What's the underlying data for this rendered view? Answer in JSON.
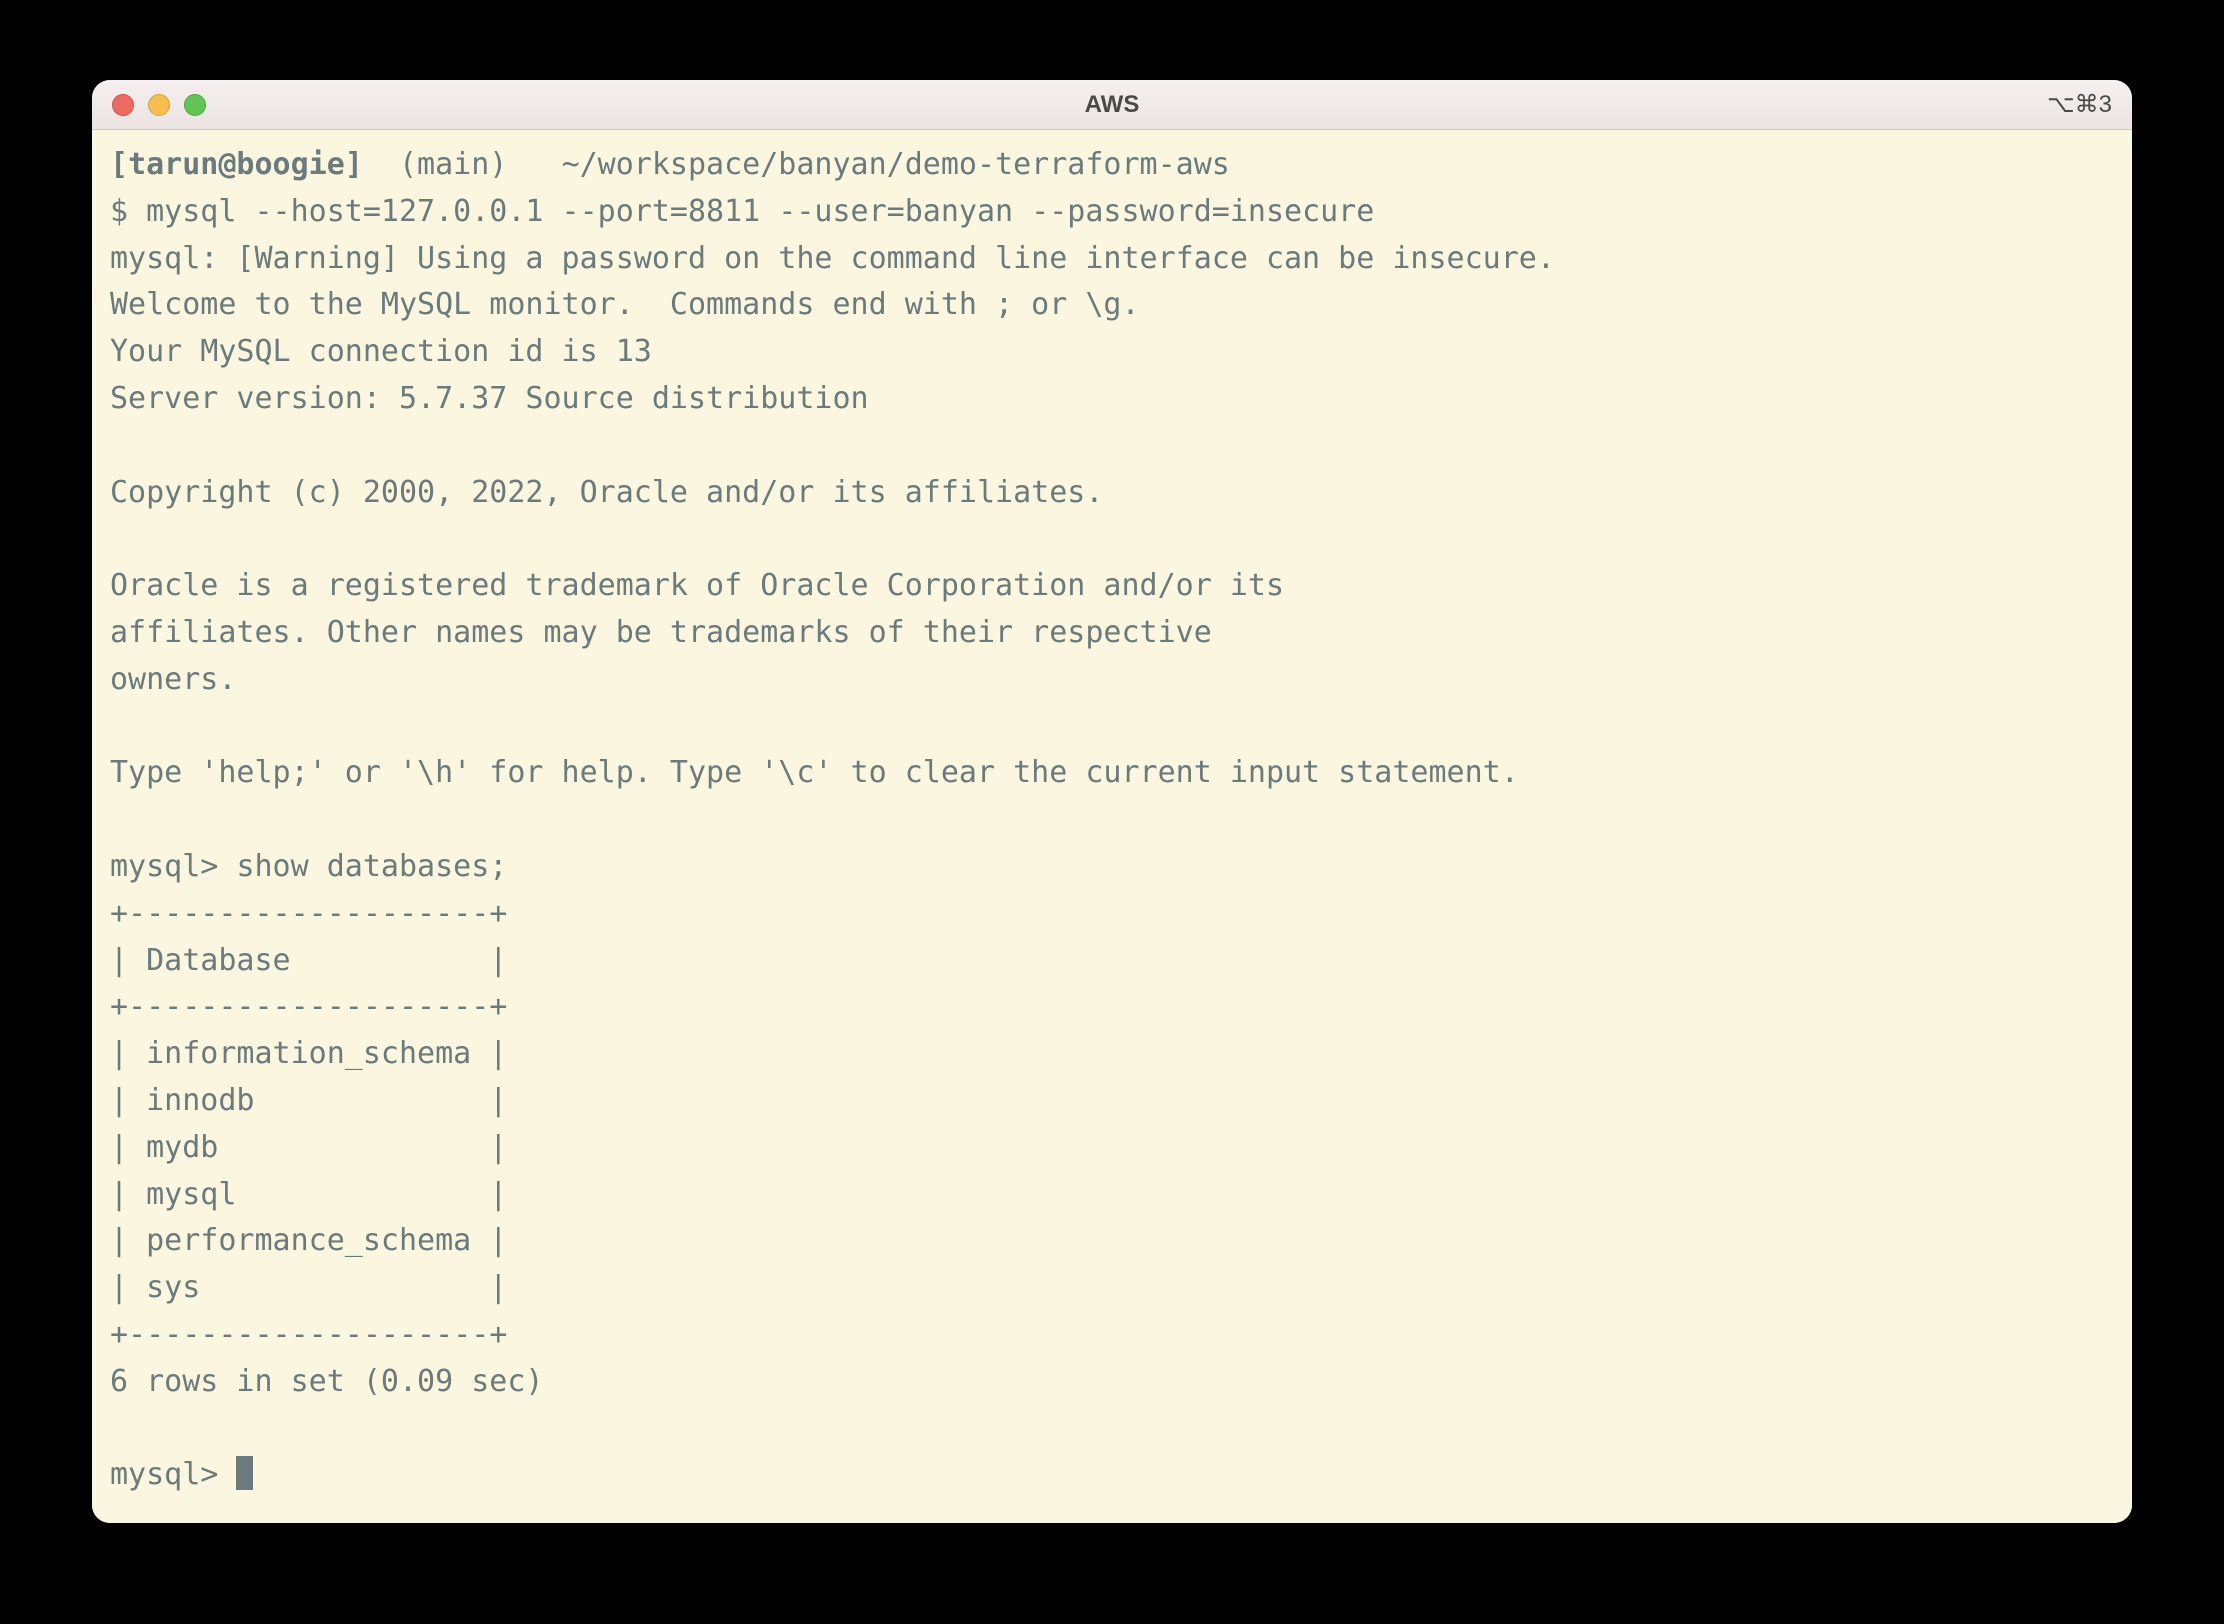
{
  "window": {
    "title": "AWS",
    "shortcut": "⌥⌘3"
  },
  "prompt": {
    "user_host": "tarun@boogie",
    "branch": "(main)",
    "path": "~/workspace/banyan/demo-terraform-aws",
    "prompt_char": "$",
    "command": "mysql --host=127.0.0.1 --port=8811 --user=banyan --password=insecure"
  },
  "output": {
    "line_warning": "mysql: [Warning] Using a password on the command line interface can be insecure.",
    "line_welcome": "Welcome to the MySQL monitor.  Commands end with ; or \\g.",
    "line_conn_id": "Your MySQL connection id is 13",
    "line_server": "Server version: 5.7.37 Source distribution",
    "line_copyright": "Copyright (c) 2000, 2022, Oracle and/or its affiliates.",
    "line_trademark1": "Oracle is a registered trademark of Oracle Corporation and/or its",
    "line_trademark2": "affiliates. Other names may be trademarks of their respective",
    "line_trademark3": "owners.",
    "line_help": "Type 'help;' or '\\h' for help. Type '\\c' to clear the current input statement."
  },
  "mysql": {
    "prompt": "mysql>",
    "query": "show databases;",
    "table_border": "+--------------------+",
    "table_header": "| Database           |",
    "rows": {
      "r0": "| information_schema |",
      "r1": "| innodb             |",
      "r2": "| mydb               |",
      "r3": "| mysql              |",
      "r4": "| performance_schema |",
      "r5": "| sys                |"
    },
    "result_summary": "6 rows in set (0.09 sec)"
  }
}
